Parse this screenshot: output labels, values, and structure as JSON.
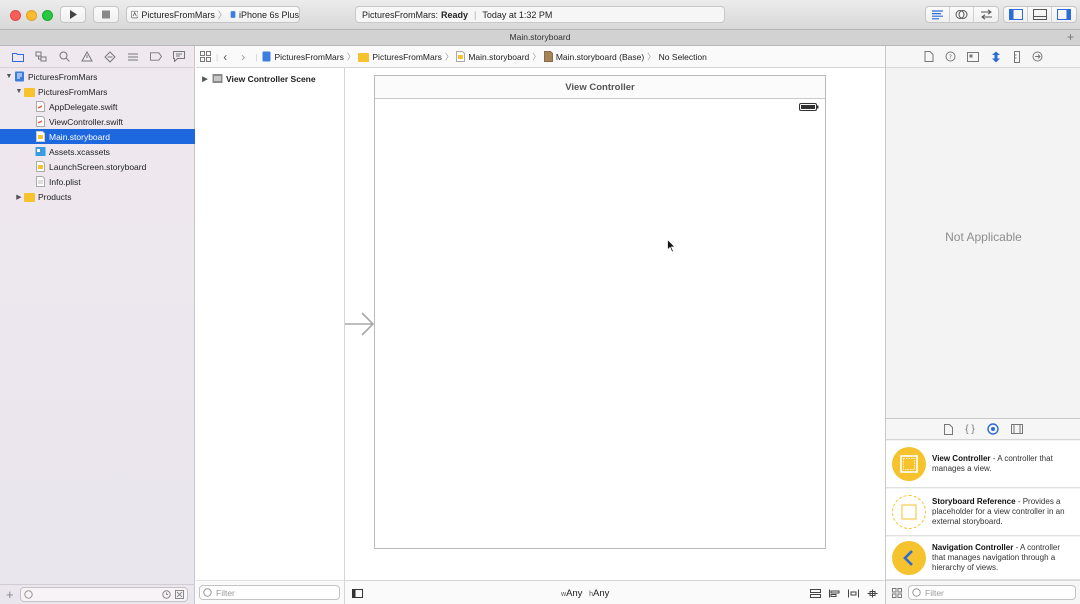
{
  "toolbar": {
    "scheme_target": "PicturesFromMars",
    "scheme_device": "iPhone 6s Plus",
    "status_project": "PicturesFromMars:",
    "status_state": "Ready",
    "status_time": "Today at 1:32 PM"
  },
  "tab": {
    "title": "Main.storyboard"
  },
  "navigator": {
    "items": [
      {
        "label": "PicturesFromMars",
        "level": 0,
        "type": "project",
        "expanded": true
      },
      {
        "label": "PicturesFromMars",
        "level": 1,
        "type": "folder",
        "expanded": true
      },
      {
        "label": "AppDelegate.swift",
        "level": 2,
        "type": "swift"
      },
      {
        "label": "ViewController.swift",
        "level": 2,
        "type": "swift"
      },
      {
        "label": "Main.storyboard",
        "level": 2,
        "type": "storyboard",
        "selected": true
      },
      {
        "label": "Assets.xcassets",
        "level": 2,
        "type": "assets"
      },
      {
        "label": "LaunchScreen.storyboard",
        "level": 2,
        "type": "storyboard"
      },
      {
        "label": "Info.plist",
        "level": 2,
        "type": "plist"
      },
      {
        "label": "Products",
        "level": 1,
        "type": "folder",
        "expanded": false
      }
    ],
    "filter_placeholder": ""
  },
  "jumpbar": {
    "crumbs": [
      "PicturesFromMars",
      "PicturesFromMars",
      "Main.storyboard",
      "Main.storyboard (Base)",
      "No Selection"
    ]
  },
  "outline": {
    "scene": "View Controller Scene",
    "filter_placeholder": "Filter"
  },
  "canvas": {
    "view_controller_title": "View Controller"
  },
  "size_class": {
    "w_label": "w",
    "w_value": "Any",
    "h_label": "h",
    "h_value": "Any"
  },
  "inspector": {
    "not_applicable": "Not Applicable",
    "library": [
      {
        "name": "View Controller",
        "desc": " - A controller that manages a view."
      },
      {
        "name": "Storyboard Reference",
        "desc": " - Provides a placeholder for a view controller in an external storyboard."
      },
      {
        "name": "Navigation Controller",
        "desc": " - A controller that manages navigation through a hierarchy of views."
      }
    ],
    "filter_placeholder": "Filter"
  },
  "colors": {
    "selection": "#1d67df",
    "library_icon": "#f6c22d",
    "close": "#fc5f57",
    "minimize": "#fdbc2e",
    "zoom": "#28c840"
  }
}
